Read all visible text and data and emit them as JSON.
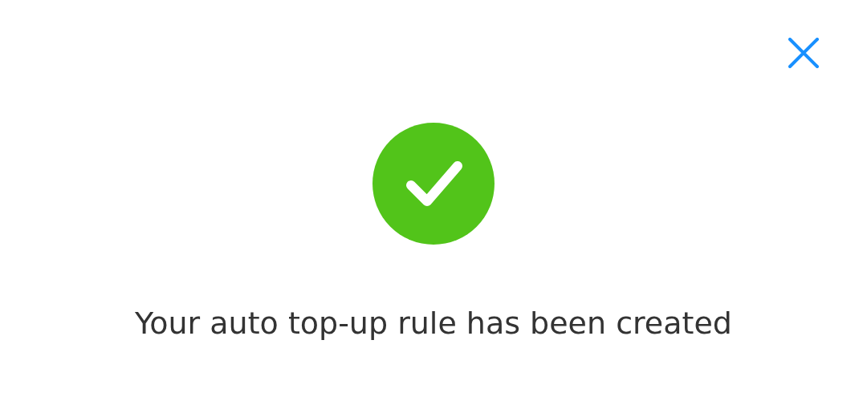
{
  "dialog": {
    "message": "Your auto top-up rule has been created",
    "success": true
  }
}
